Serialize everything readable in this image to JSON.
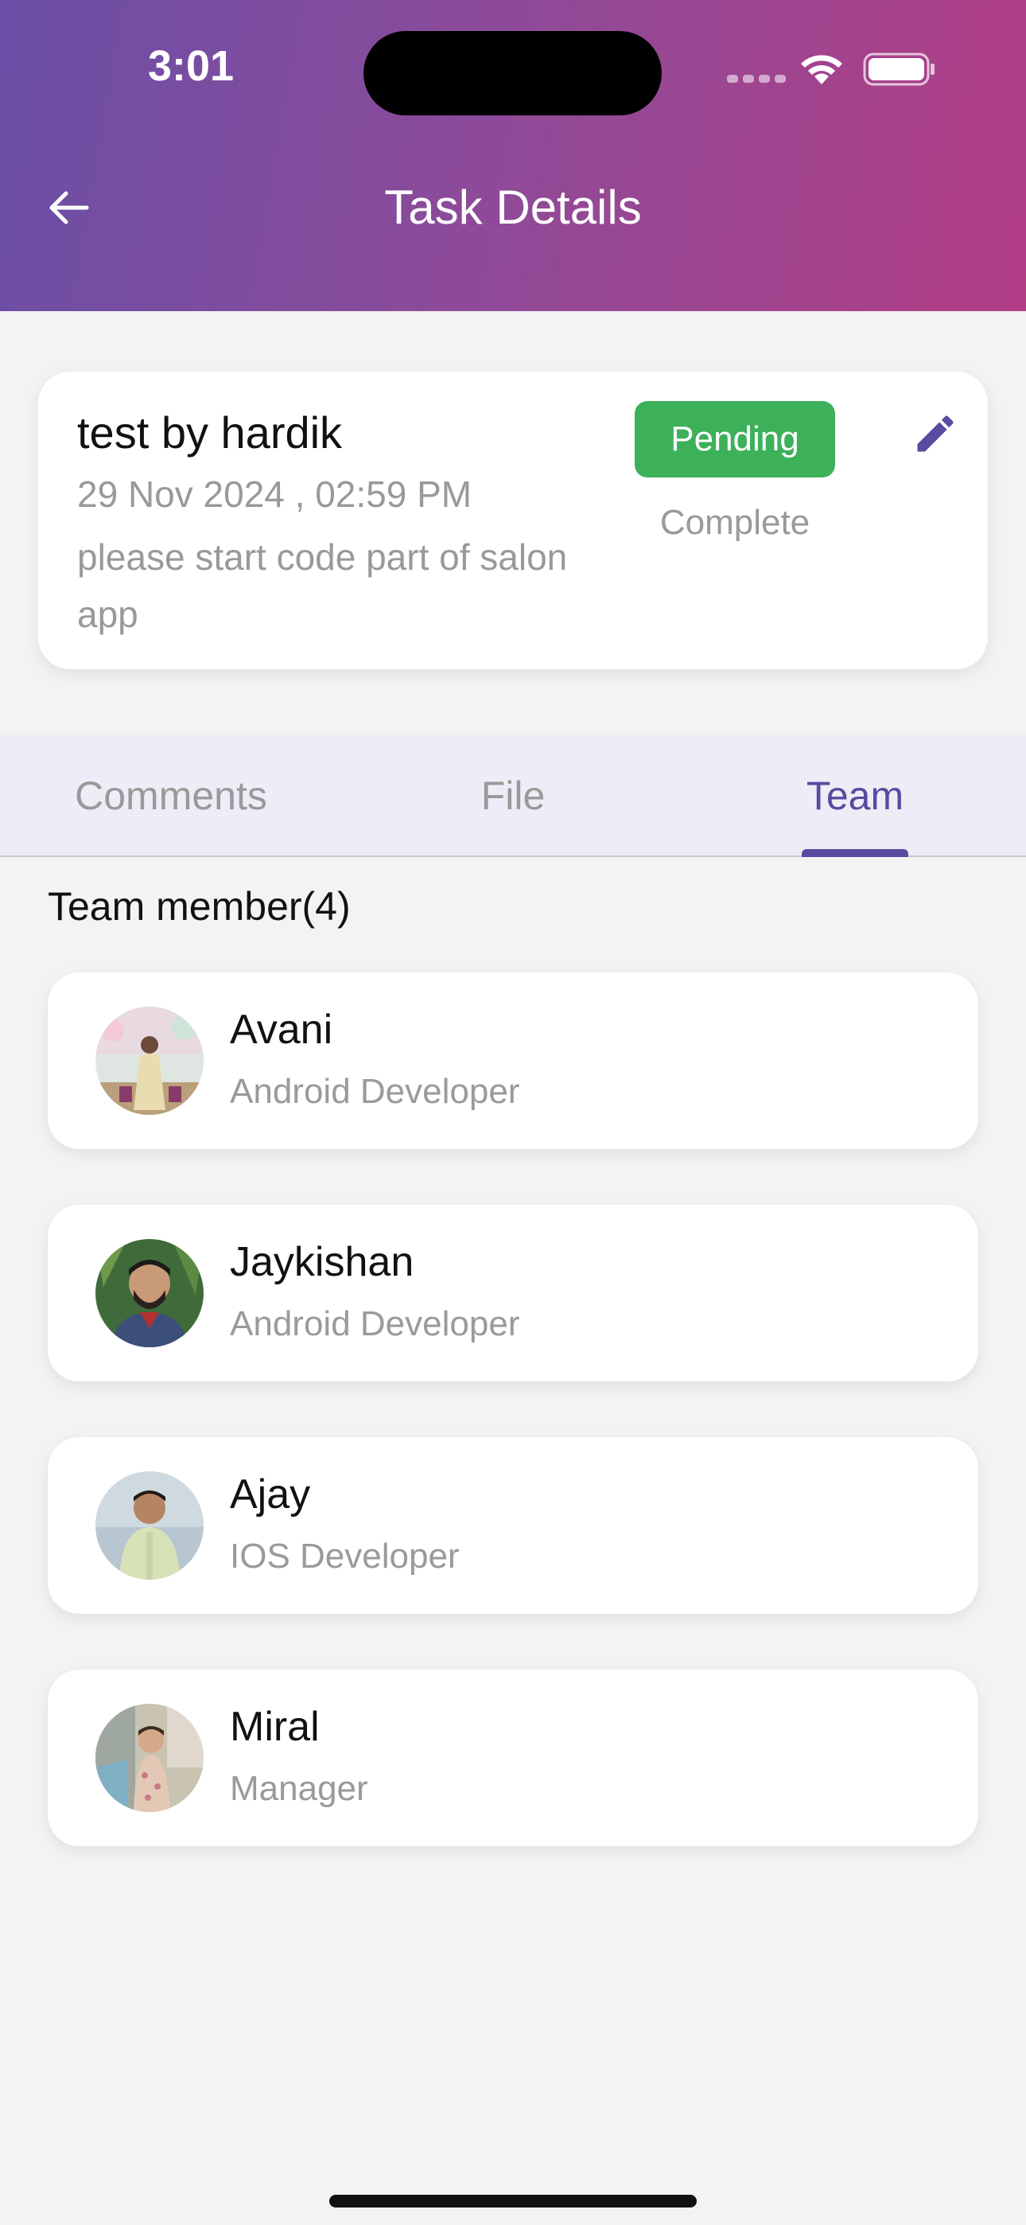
{
  "status_bar": {
    "time": "3:01"
  },
  "header": {
    "title": "Task Details",
    "back_icon": "arrow-left-icon"
  },
  "task": {
    "title": "test by hardik",
    "date": "29 Nov 2024 , 02:59 PM",
    "description": "please start code part of salon app",
    "status_pending_label": "Pending",
    "status_complete_label": "Complete",
    "edit_icon": "pencil-icon"
  },
  "tabs": [
    {
      "label": "Comments",
      "active": false
    },
    {
      "label": "File",
      "active": false
    },
    {
      "label": "Team",
      "active": true
    }
  ],
  "team": {
    "heading": "Team member(4)",
    "members": [
      {
        "name": "Avani",
        "role": "Android Developer"
      },
      {
        "name": "Jaykishan",
        "role": "Android Developer"
      },
      {
        "name": "Ajay",
        "role": "IOS Developer"
      },
      {
        "name": "Miral",
        "role": "Manager"
      }
    ]
  },
  "colors": {
    "accent": "#5a4aa0",
    "pending": "#3db05a",
    "header_gradient_start": "#6a4fa6",
    "header_gradient_end": "#b23d85"
  }
}
